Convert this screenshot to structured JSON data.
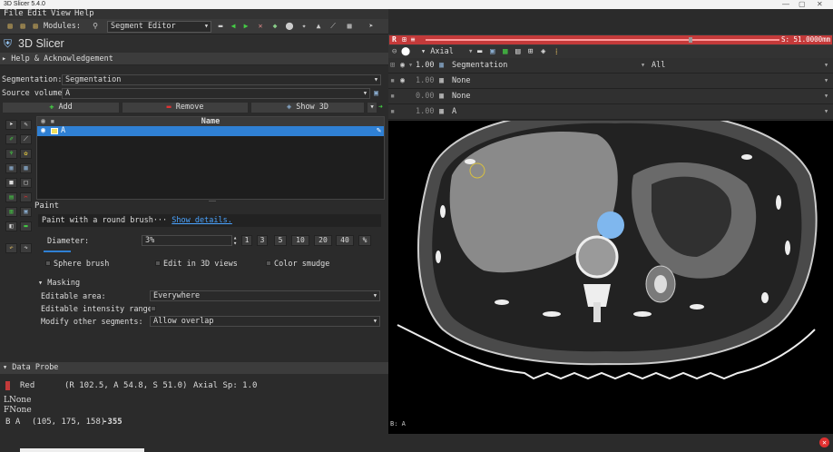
{
  "window": {
    "title": "3D Slicer 5.4.0",
    "controls": [
      "—",
      "▢",
      "✕"
    ]
  },
  "menu": [
    "File",
    "Edit",
    "View",
    "Help"
  ],
  "toolbar": {
    "modules_label": "Modules:",
    "module_selected": "Segment Editor"
  },
  "app_title": "3D Slicer",
  "help_section": "Help & Acknowledgement",
  "segmentation": {
    "label": "Segmentation:",
    "value": "Segmentation"
  },
  "source_volume": {
    "label": "Source volume:",
    "value": "A"
  },
  "seg_buttons": {
    "add": "Add",
    "remove": "Remove",
    "show3d": "Show 3D"
  },
  "seg_table": {
    "header_name": "Name",
    "rows": [
      {
        "name": "A",
        "color": "#f0e060"
      }
    ]
  },
  "paint": {
    "title": "Paint",
    "description": "Paint with a round brush···",
    "show_details": "Show details.",
    "diameter_label": "Diameter:",
    "diameter_value": "3%",
    "diameter_presets": [
      "1",
      "3",
      "5",
      "10",
      "20",
      "40",
      "%"
    ],
    "sphere_brush": "Sphere brush",
    "edit_3d": "Edit in 3D views",
    "color_smudge": "Color smudge"
  },
  "masking": {
    "title": "Masking",
    "editable_area_label": "Editable area:",
    "editable_area_value": "Everywhere",
    "intensity_label": "Editable intensity range:",
    "modify_label": "Modify other segments:",
    "modify_value": "Allow overlap"
  },
  "data_probe": {
    "title": "Data Probe",
    "view": "Red",
    "ras": "(R 102.5, A 54.8, S 51.0)",
    "orientation": "Axial Sp: 1.0",
    "l_layer": "None",
    "f_layer": "None",
    "b_label": "B",
    "b_layer": "A",
    "b_ijk": "(105, 175, 158)",
    "b_value": "-355"
  },
  "slice_view": {
    "name": "R",
    "offset": "S: 51.0000mm",
    "orientation": "Axial",
    "seg_opacity": "1.00",
    "seg_name": "Segmentation",
    "seg_show": "All",
    "fg_opacity": "1.00",
    "fg_name": "None",
    "label_opacity": "0.00",
    "label_name": "None",
    "bg_opacity": "1.00",
    "bg_name": "A",
    "corner_label": "B: A"
  },
  "colors": {
    "accent": "#2f80d4",
    "red_view": "#c43a3a",
    "segment": "#7fb7ee",
    "link": "#4aa3ff"
  }
}
